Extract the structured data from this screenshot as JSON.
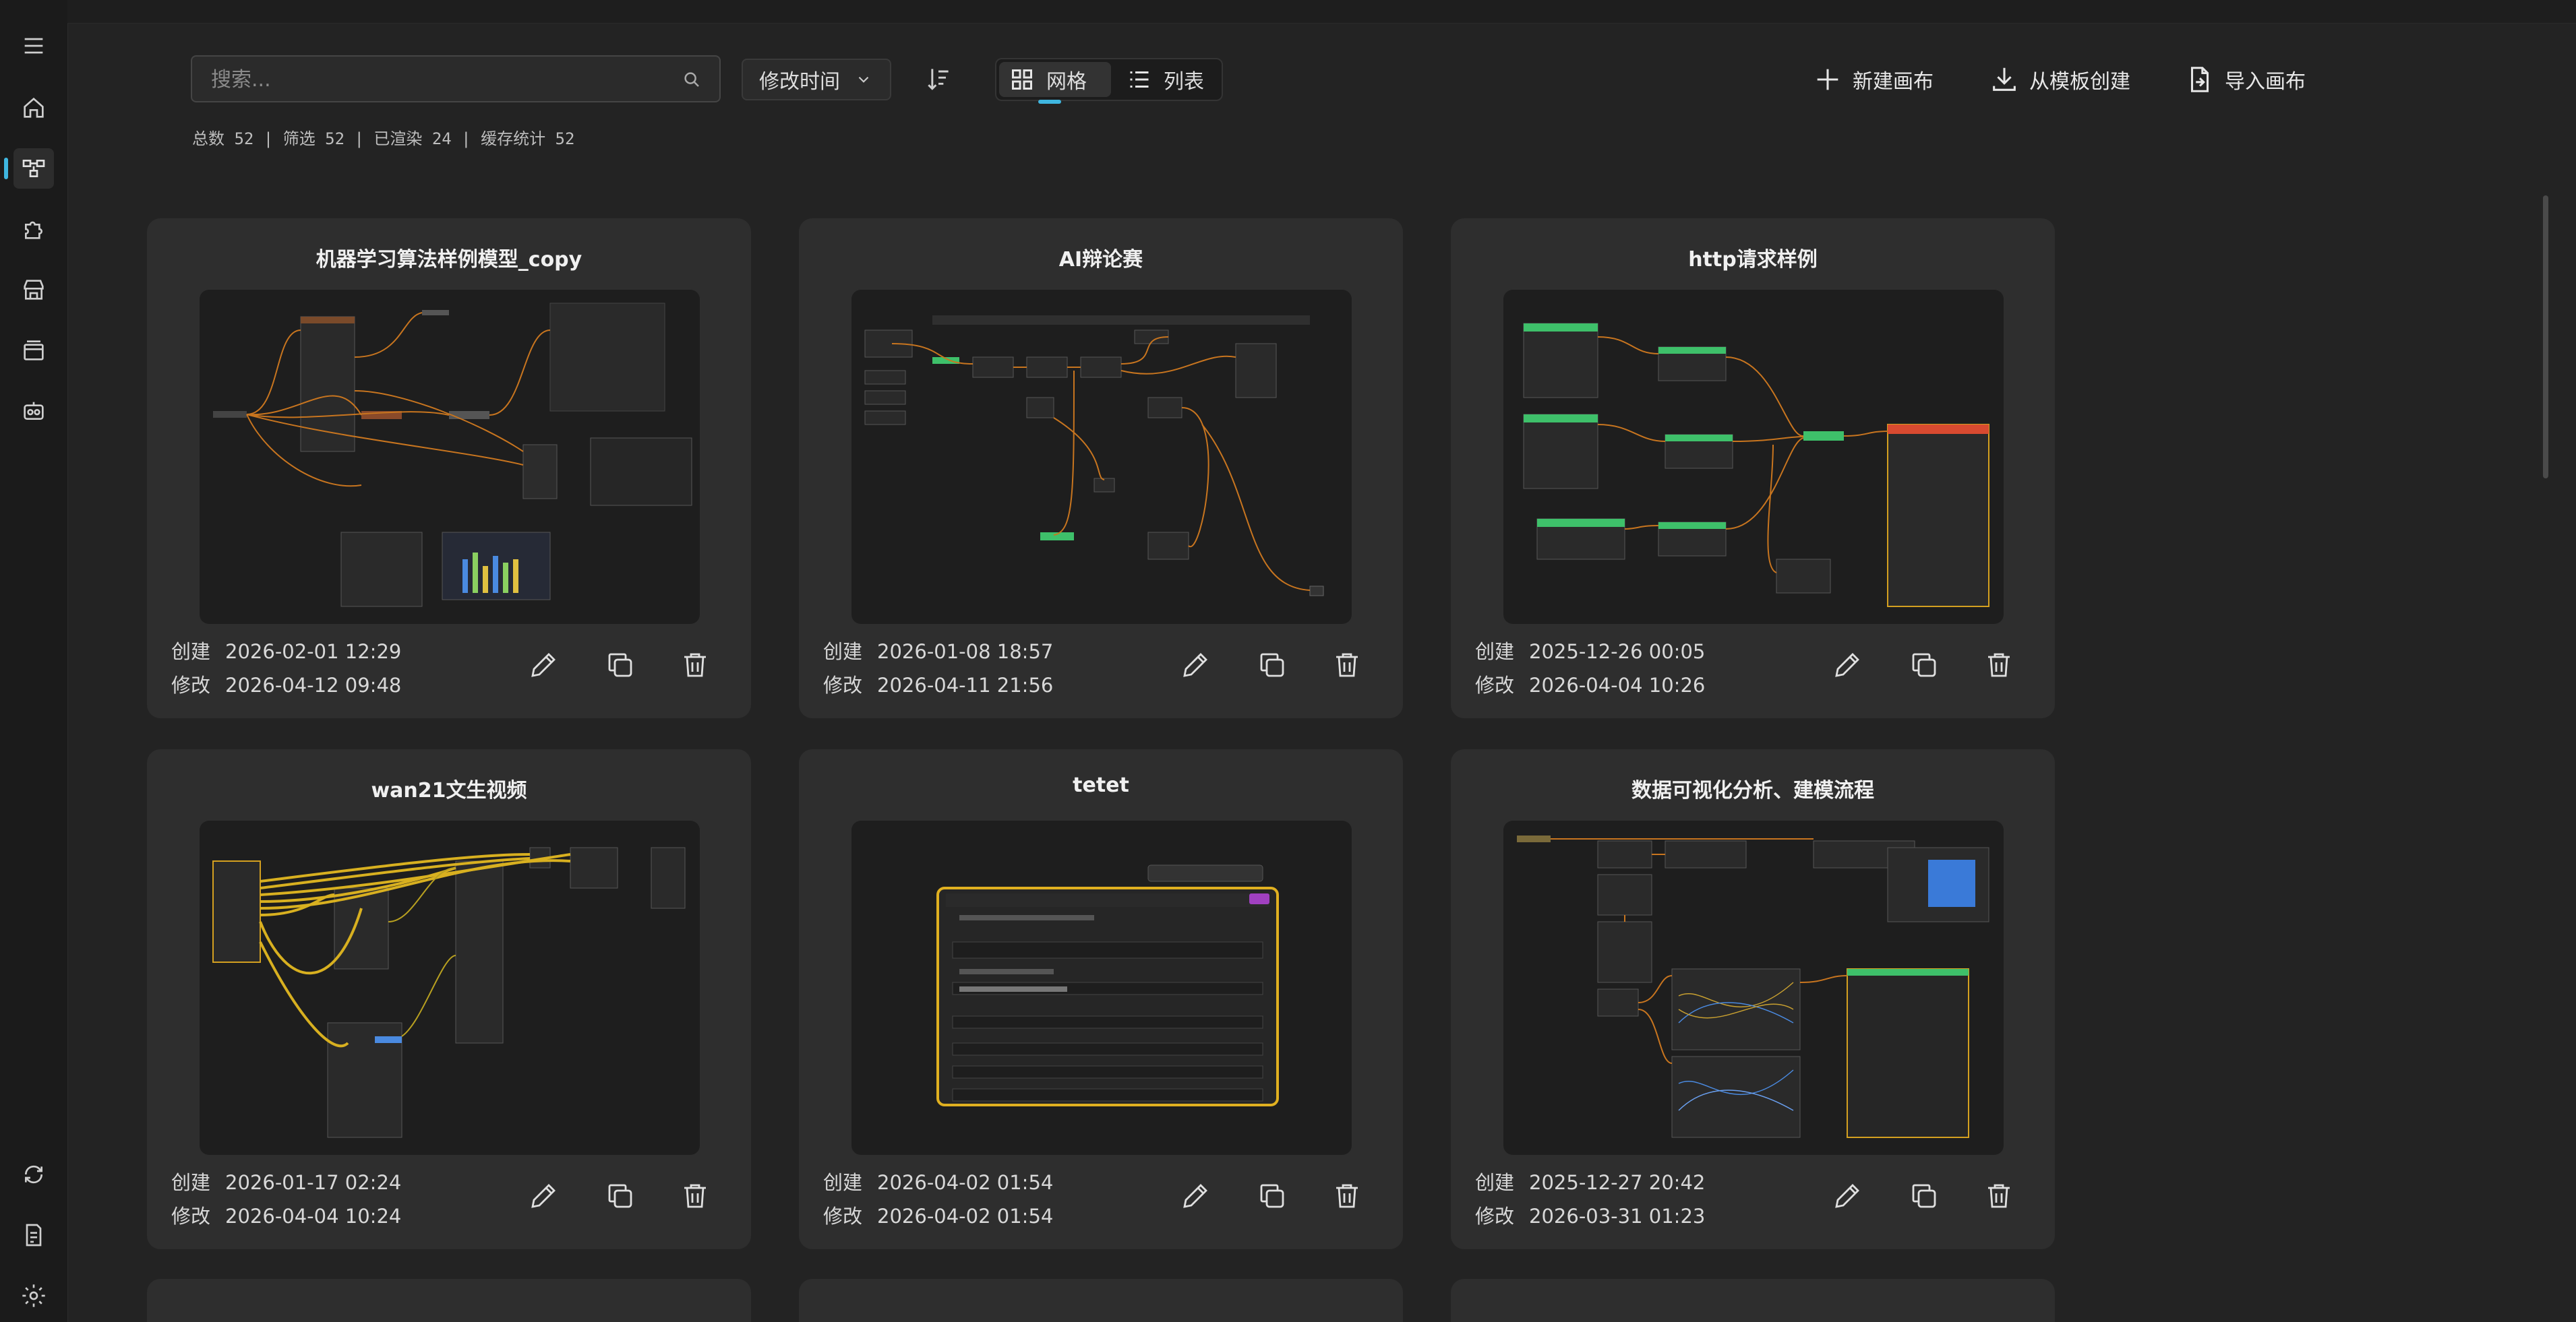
{
  "search": {
    "placeholder": "搜索..."
  },
  "toolbar": {
    "sort_label": "修改时间",
    "view_grid_label": "网格",
    "view_list_label": "列表",
    "new_canvas_label": "新建画布",
    "from_template_label": "从模板创建",
    "import_label": "导入画布"
  },
  "stats": "总数 52 | 筛选 52 | 已渲染 24 | 缓存统计 52",
  "sidebar": {
    "items": [
      "menu-icon",
      "home-icon",
      "workflow-icon",
      "plugin-icon",
      "store-icon",
      "gallery-icon",
      "robot-icon"
    ],
    "bottom": [
      "sync-icon",
      "log-icon",
      "settings-icon"
    ],
    "active": "workflow-icon"
  },
  "accent_color": "#3fb6e0",
  "cards": [
    {
      "title": "机器学习算法样例模型_copy",
      "created_label": "创建",
      "created": "2026-02-01 12:29",
      "modified_label": "修改",
      "modified": "2026-04-12 09:48"
    },
    {
      "title": "AI辩论赛",
      "created_label": "创建",
      "created": "2026-01-08 18:57",
      "modified_label": "修改",
      "modified": "2026-04-11 21:56"
    },
    {
      "title": "http请求样例",
      "created_label": "创建",
      "created": "2025-12-26 00:05",
      "modified_label": "修改",
      "modified": "2026-04-04 10:26"
    },
    {
      "title": "wan21文生视频",
      "created_label": "创建",
      "created": "2026-01-17 02:24",
      "modified_label": "修改",
      "modified": "2026-04-04 10:24"
    },
    {
      "title": "tetet",
      "created_label": "创建",
      "created": "2026-04-02 01:54",
      "modified_label": "修改",
      "modified": "2026-04-02 01:54"
    },
    {
      "title": "数据可视化分析、建模流程",
      "created_label": "创建",
      "created": "2025-12-27 20:42",
      "modified_label": "修改",
      "modified": "2026-03-31 01:23"
    }
  ]
}
